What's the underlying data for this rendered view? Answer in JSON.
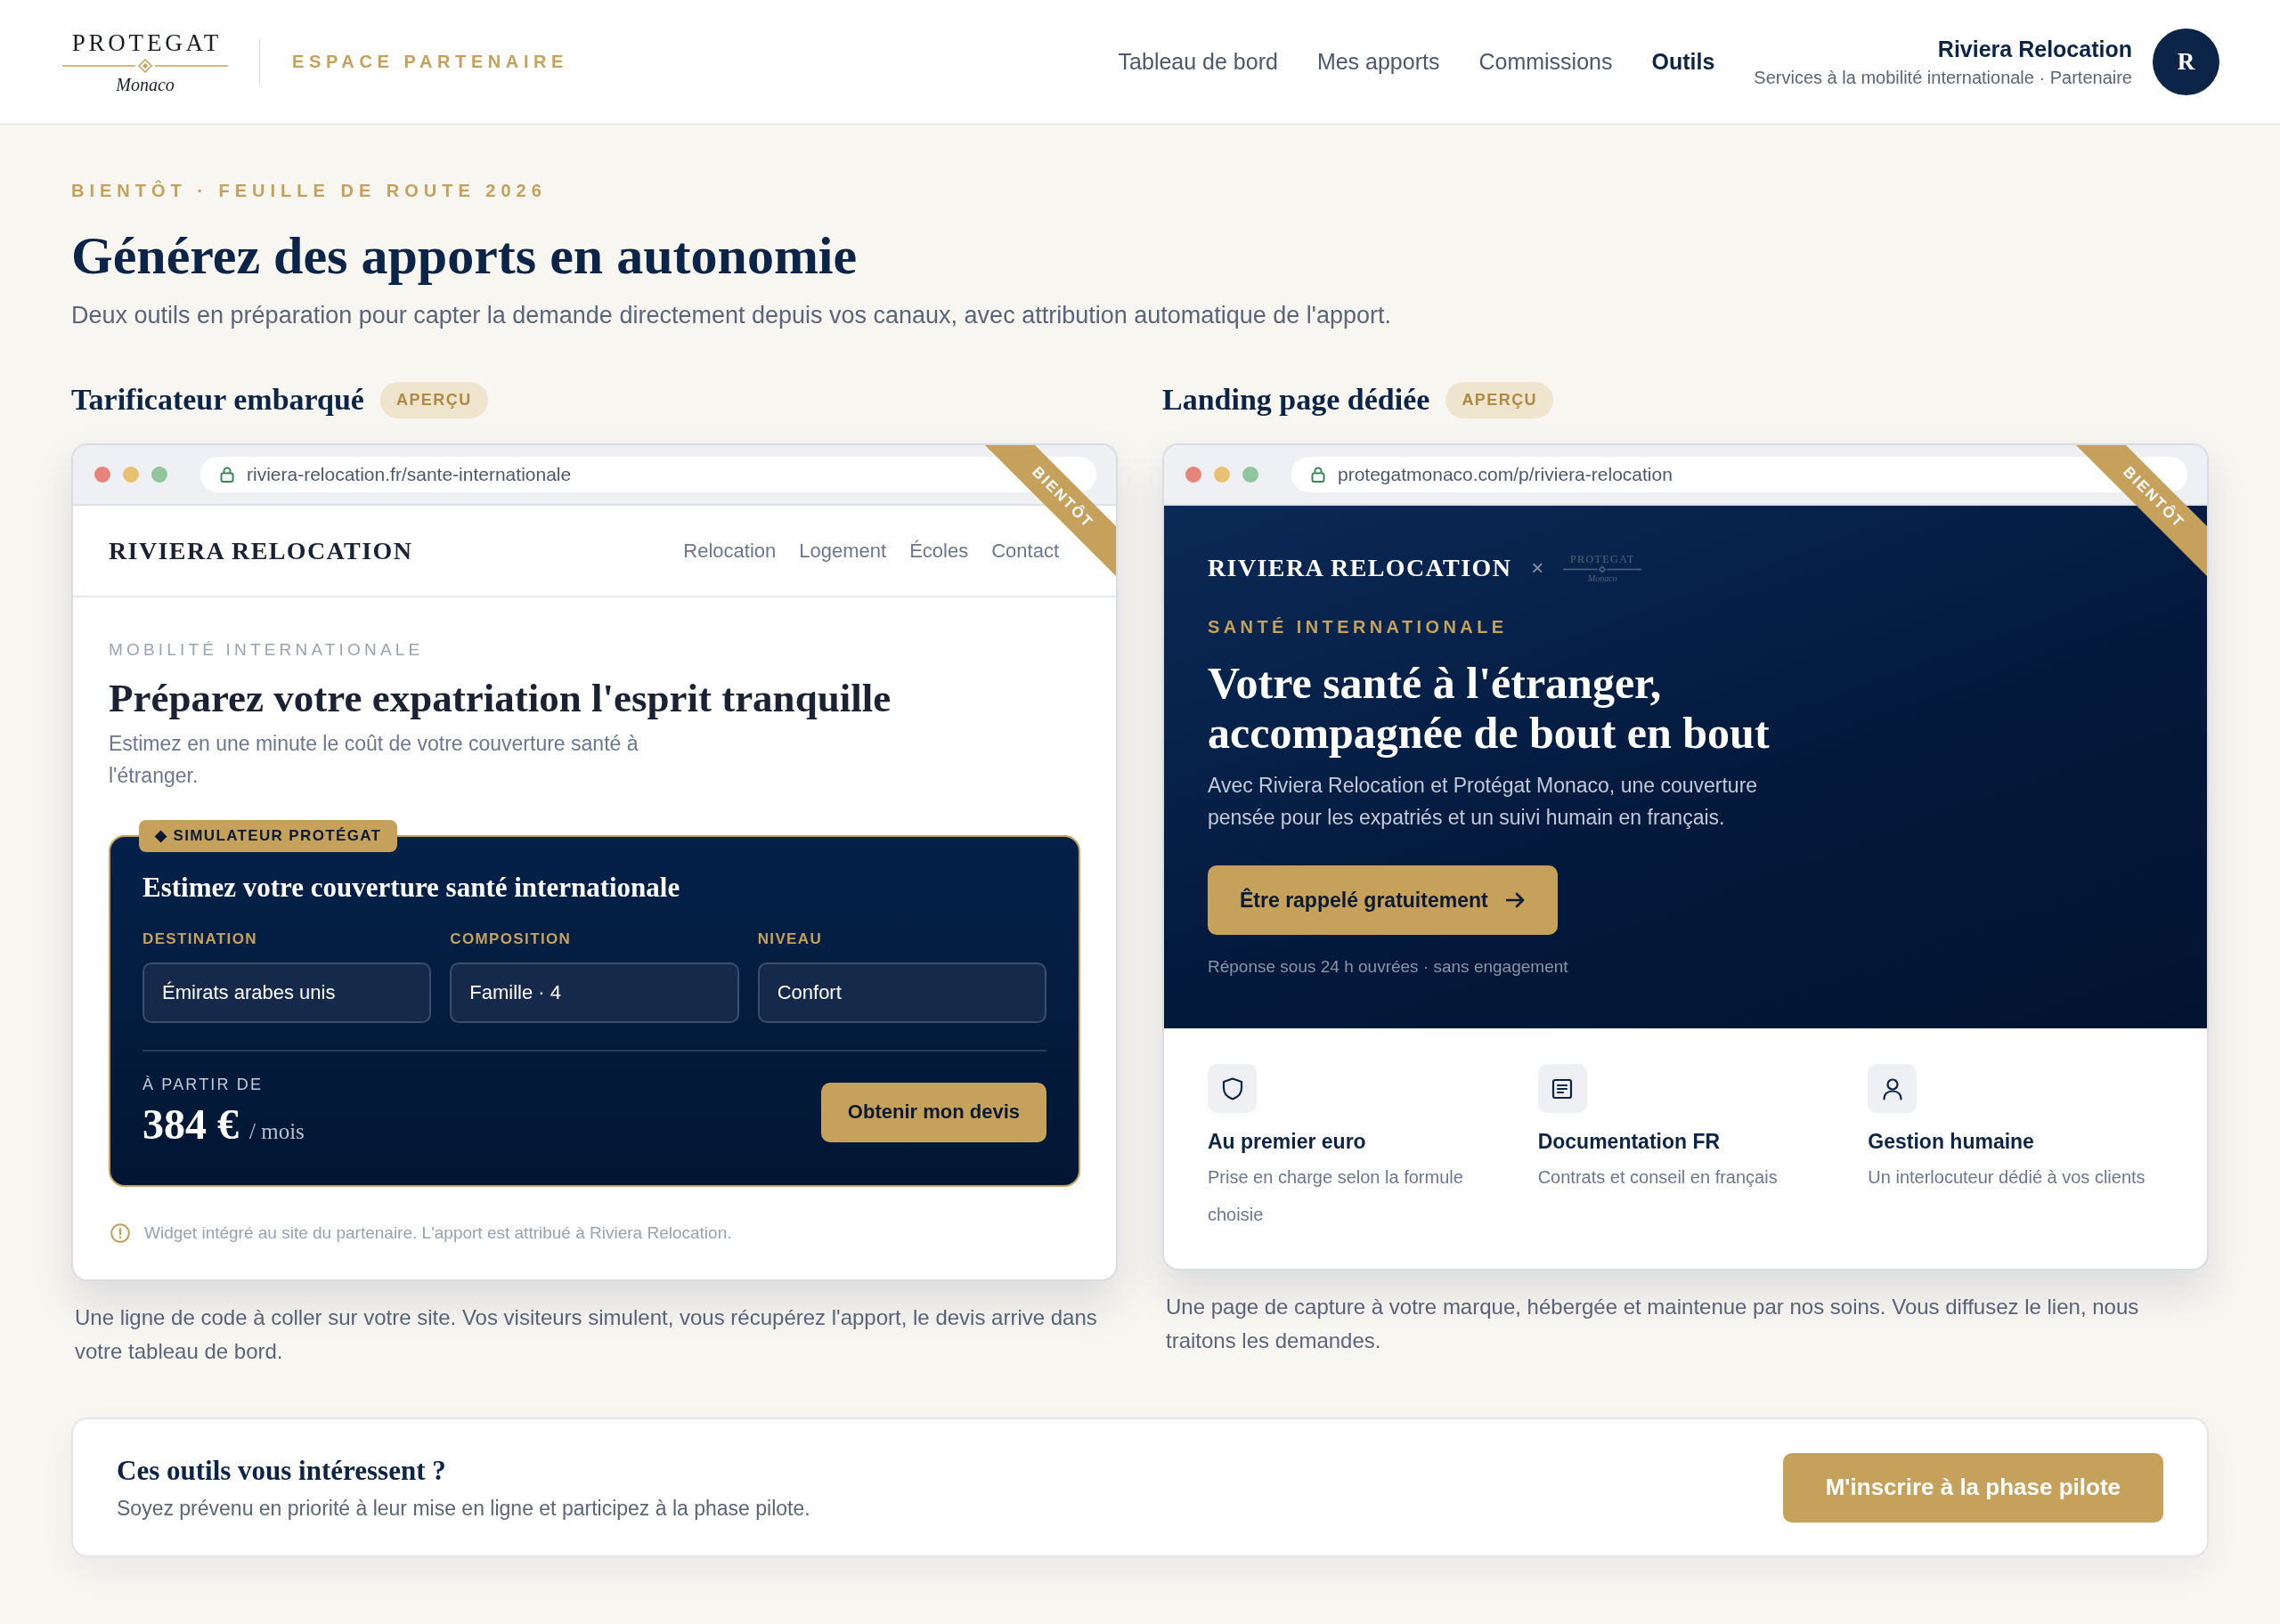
{
  "header": {
    "logo": {
      "wordmark": "PROTEGAT",
      "tagline": "Monaco"
    },
    "portal_label": "ESPACE PARTENAIRE",
    "nav": [
      {
        "label": "Tableau de bord",
        "selected": false
      },
      {
        "label": "Mes apports",
        "selected": false
      },
      {
        "label": "Commissions",
        "selected": false
      },
      {
        "label": "Outils",
        "selected": true
      }
    ],
    "account": {
      "name": "Riviera Relocation",
      "subtitle": "Services à la mobilité internationale · Partenaire",
      "avatar_initial": "R"
    }
  },
  "intro": {
    "eyebrow": "BIENTÔT · FEUILLE DE ROUTE 2026",
    "title": "Générez des apports en autonomie",
    "description": "Deux outils en préparation pour capter la demande directement depuis vos canaux, avec attribution automatique de l'apport."
  },
  "tools": [
    {
      "kind": "widget",
      "title": "Tarificateur embarqué",
      "badge": "APERÇU",
      "preview": {
        "url": "riviera-relocation.fr/sante-internationale",
        "ribbon": "BIENTÔT",
        "site_name": "RIVIERA RELOCATION",
        "site_nav": [
          "Relocation",
          "Logement",
          "Écoles",
          "Contact"
        ],
        "eyebrow": "MOBILITÉ INTERNATIONALE",
        "headline": "Préparez votre expatriation l'esprit tranquille",
        "lead": "Estimez en une minute le coût de votre couverture santé à l'étranger.",
        "simulator": {
          "tag": "◆ SIMULATEUR PROTÉGAT",
          "title": "Estimez votre couverture santé internationale",
          "fields": [
            {
              "label": "DESTINATION",
              "value": "Émirats arabes unis"
            },
            {
              "label": "COMPOSITION",
              "value": "Famille · 4"
            },
            {
              "label": "NIVEAU",
              "value": "Confort"
            }
          ],
          "price_label": "À PARTIR DE",
          "price": "384 €",
          "price_unit": "/ mois",
          "button": "Obtenir mon devis"
        },
        "note": "Widget intégré au site du partenaire. L'apport est attribué à Riviera Relocation."
      },
      "caption": "Une ligne de code à coller sur votre site. Vos visiteurs simulent, vous récupérez l'apport, le devis arrive dans votre tableau de bord."
    },
    {
      "kind": "landing",
      "title": "Landing page dédiée",
      "badge": "APERÇU",
      "preview": {
        "url": "protegatmonaco.com/p/riviera-relocation",
        "ribbon": "BIENTÔT",
        "site_name": "RIVIERA RELOCATION",
        "separator": "×",
        "partner_logo": {
          "wordmark": "PROTEGAT",
          "tagline": "Monaco"
        },
        "eyebrow": "SANTÉ INTERNATIONALE",
        "headline": "Votre santé à l'étranger, accompagnée de bout en bout",
        "lead": "Avec Riviera Relocation et Protégat Monaco, une couverture pensée pour les expatriés et un suivi humain en français.",
        "button": "Être rappelé gratuitement",
        "note": "Réponse sous 24 h ouvrées · sans engagement",
        "features": [
          {
            "title": "Au premier euro",
            "description": "Prise en charge selon la formule choisie"
          },
          {
            "title": "Documentation FR",
            "description": "Contrats et conseil en français"
          },
          {
            "title": "Gestion humaine",
            "description": "Un interlocuteur dédié à vos clients"
          }
        ]
      },
      "caption": "Une page de capture à votre marque, hébergée et maintenue par nos soins. Vous diffusez le lien, nous traitons les demandes."
    }
  ],
  "cta": {
    "title": "Ces outils vous intéressent ?",
    "description": "Soyez prévenu en priorité à leur mise en ligne et participez à la phase pilote.",
    "button": "M'inscrire à la phase pilote"
  }
}
